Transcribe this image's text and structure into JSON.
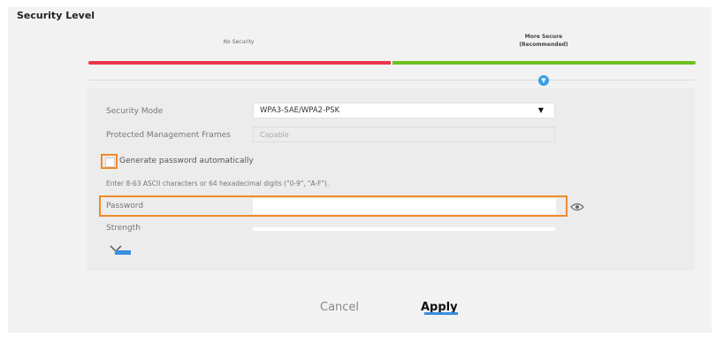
{
  "title": "Security Level",
  "security_levels": {
    "no_security": "No Security",
    "more_secure_line1": "More Secure",
    "more_secure_line2": "(Recommended)"
  },
  "form": {
    "security_mode_label": "Security Mode",
    "security_mode_value": "WPA3-SAE/WPA2-PSK",
    "pmf_label": "Protected Management Frames",
    "pmf_value": "Capable",
    "generate_password_label": "Generate password automatically",
    "generate_password_checked": false,
    "hint": "Enter 8-63 ASCII characters or 64 hexadecimal digits (\"0-9\", \"A-F\").",
    "password_label": "Password",
    "password_value": "",
    "strength_label": "Strength"
  },
  "buttons": {
    "cancel": "Cancel",
    "apply": "Apply"
  },
  "colors": {
    "insecure": "#e8364a",
    "secure": "#6cc21e",
    "highlight": "#f08a2b",
    "accent": "#3aa0e6"
  },
  "icons": {
    "level_pointer": "chevron-down-icon",
    "show_password": "eye-icon",
    "collapse": "chevron-up-icon"
  }
}
